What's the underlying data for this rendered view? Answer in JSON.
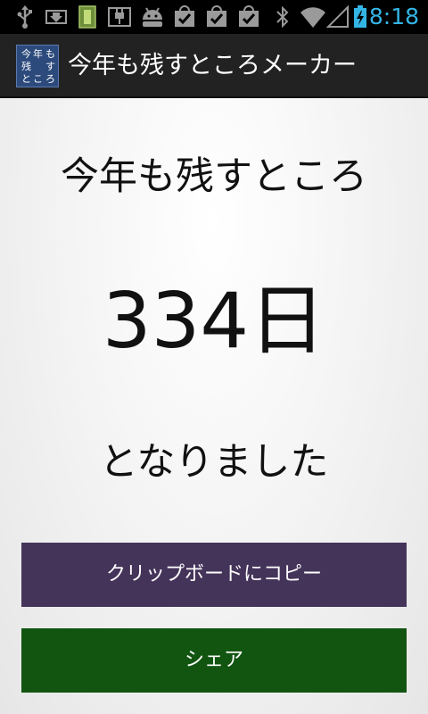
{
  "status_bar": {
    "time": "8:18",
    "icons": [
      "usb-icon",
      "download-icon",
      "sd-card-icon",
      "usb-debug-icon",
      "android-icon",
      "store-check-icon",
      "store-check-icon",
      "store-check-icon",
      "bluetooth-icon",
      "wifi-icon",
      "signal-icon",
      "battery-charging-icon"
    ],
    "accent_color": "#33b5e5"
  },
  "action_bar": {
    "title": "今年も残すところメーカー",
    "icon_text": [
      "今",
      "年",
      "も",
      "残",
      "す",
      "と",
      "こ",
      "ろ"
    ],
    "icon_bg": "#2c4a7c"
  },
  "main": {
    "headline": "今年も残すところ",
    "days": "334日",
    "suffix": "となりました"
  },
  "buttons": {
    "copy": {
      "label": "クリップボードにコピー",
      "color": "#45345a"
    },
    "share": {
      "label": "シェア",
      "color": "#115511"
    }
  }
}
